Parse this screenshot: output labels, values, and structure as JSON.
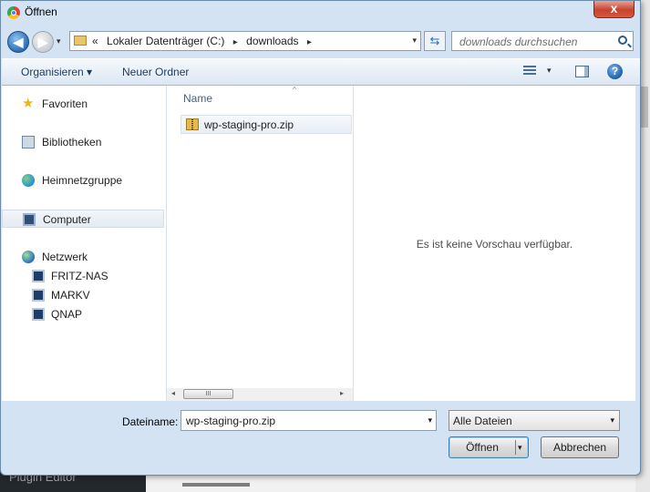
{
  "background": {
    "sidebar_text": "Plugin Editor"
  },
  "window": {
    "title": "Öffnen",
    "close_glyph": "x"
  },
  "nav": {
    "back_glyph": "◀",
    "forward_glyph": "▶",
    "history_dropdown": "▾",
    "breadcrumb": [
      "«",
      "Lokaler Datenträger (C:)",
      "▸",
      "downloads",
      "▸"
    ],
    "address_dropdown": "▾",
    "refresh_glyph": "⇆",
    "search_placeholder": "downloads durchsuchen"
  },
  "toolbar": {
    "organize_label": "Organisieren ▾",
    "new_folder_label": "Neuer Ordner",
    "view_dropdown": "▾",
    "help_glyph": "?"
  },
  "navpane": {
    "favorites": "Favoriten",
    "libraries": "Bibliotheken",
    "homegroup": "Heimnetzgruppe",
    "computer": "Computer",
    "network": "Netzwerk",
    "network_items": [
      "FRITZ-NAS",
      "MARKV",
      "QNAP"
    ]
  },
  "filepane": {
    "column_name": "Name",
    "sort_glyph": "^",
    "files": [
      {
        "name": "wp-staging-pro.zip"
      }
    ],
    "scroll_left": "◂",
    "scroll_right": "▸",
    "scroll_grip": "III"
  },
  "preview": {
    "text": "Es ist keine Vorschau verfügbar."
  },
  "footer": {
    "filename_label": "Dateiname:",
    "filename_value": "wp-staging-pro.zip",
    "filename_dropdown": "▾",
    "filetype_value": "Alle Dateien",
    "filetype_dropdown": "▾",
    "open_label": "Öffnen",
    "open_dropdown": "▾",
    "cancel_label": "Abbrechen"
  },
  "icons": {
    "favorites": "star-icon",
    "libraries": "library-icon",
    "homegroup": "homegroup-icon",
    "computer": "computer-icon",
    "network": "network-icon",
    "network_item": "network-computer-icon",
    "file": "zip-folder-icon"
  }
}
